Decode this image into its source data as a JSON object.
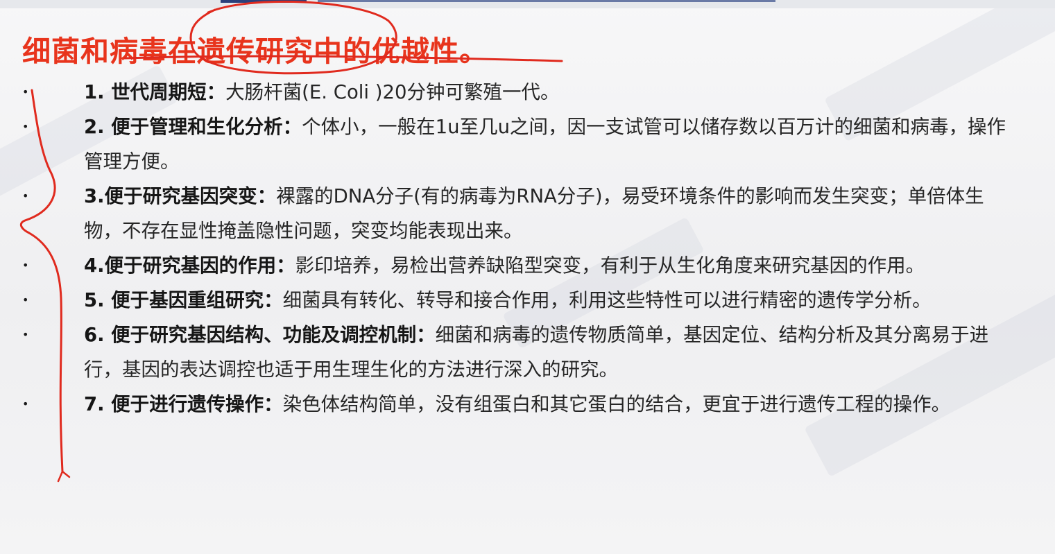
{
  "title": "细菌和病毒在遗传研究中的优越性。",
  "bullet_symbol": "•",
  "items": [
    {
      "head": "1. 世代周期短：",
      "body": "大肠杆菌(E. Coli )20分钟可繁殖一代。"
    },
    {
      "head": "2. 便于管理和生化分析：",
      "body": "个体小，一般在1u至几u之间，因一支试管可以储存数以百万计的细菌和病毒，操作管理方便。"
    },
    {
      "head": "3.便于研究基因突变：",
      "body": "裸露的DNA分子(有的病毒为RNA分子)，易受环境条件的影响而发生突变；单倍体生物，不存在显性掩盖隐性问题，突变均能表现出来。"
    },
    {
      "head": "4.便于研究基因的作用：",
      "body": "影印培养，易检出营养缺陷型突变，有利于从生化角度来研究基因的作用。"
    },
    {
      "head": "5.  便于基因重组研究：",
      "body": "细菌具有转化、转导和接合作用，利用这些特性可以进行精密的遗传学分析。"
    },
    {
      "head": "6.  便于研究基因结构、功能及调控机制：",
      "body": "细菌和病毒的遗传物质简单，基因定位、结构分析及其分离易于进行，基因的表达调控也适于用生理生化的方法进行深入的研究。"
    },
    {
      "head": "7. 便于进行遗传操作：",
      "body": "染色体结构简单，没有组蛋白和其它蛋白的结合，更宜于进行遗传工程的操作。"
    }
  ],
  "colors": {
    "title": "#e8341c",
    "annotation_ink": "#e02a1e",
    "text": "#1a1a1a"
  }
}
